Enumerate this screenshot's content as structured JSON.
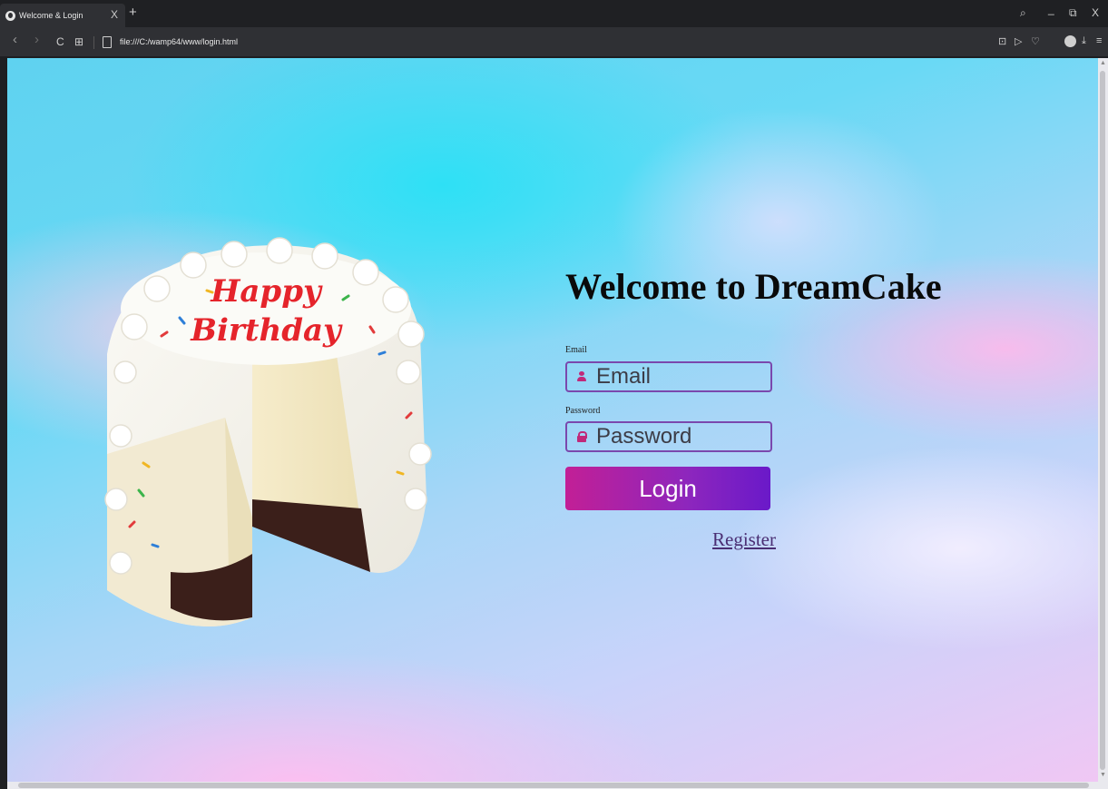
{
  "browser": {
    "tab_title": "Welcome & Login",
    "tab_close": "X",
    "new_tab": "+",
    "url": "file:///C:/wamp64/www/login.html",
    "nav": {
      "back": "‹",
      "forward": "›",
      "reload": "C",
      "apps": "⊞"
    },
    "window": {
      "search": "⌕",
      "minimize": "_",
      "restore": "⧉",
      "close": "X"
    },
    "toolbar": {
      "camera": "⊡",
      "send": "▷",
      "heart": "♡",
      "download": "⤓",
      "menu": "≡"
    }
  },
  "page": {
    "heading": "Welcome to DreamCake",
    "email_label": "Email",
    "email_placeholder": "Email",
    "password_label": "Password",
    "password_placeholder": "Password",
    "login_label": "Login",
    "register_label": "Register",
    "cake_text_line1": "Happy",
    "cake_text_line2": "Birthday"
  },
  "colors": {
    "accent_border": "#7a48ad",
    "button_start": "#c21f96",
    "button_end": "#6a19c9",
    "icon": "#c0297a"
  }
}
